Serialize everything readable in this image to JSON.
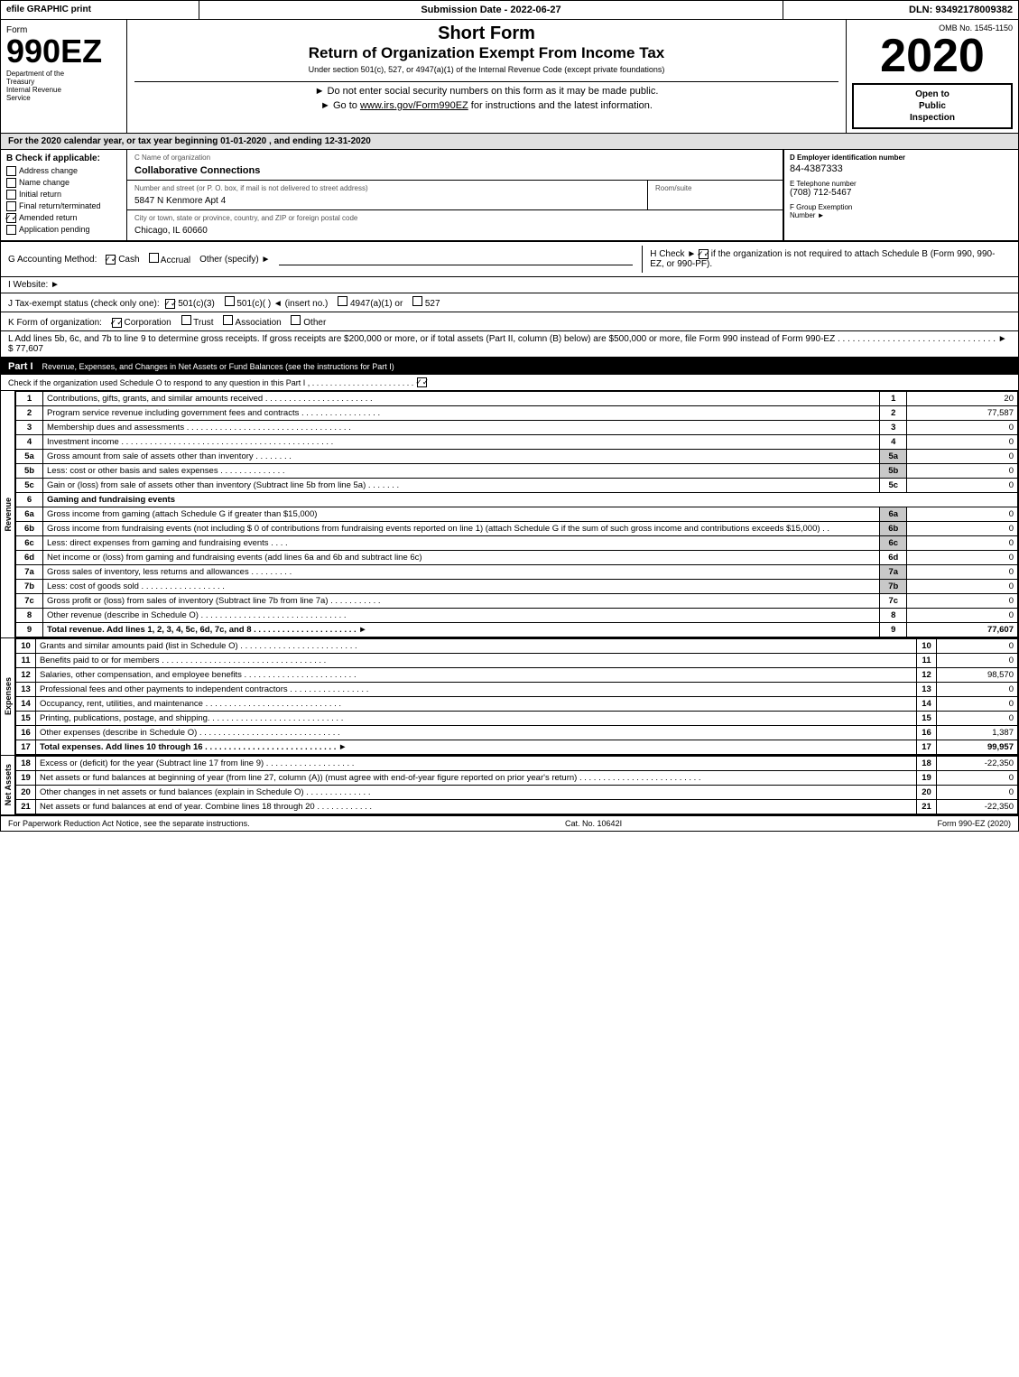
{
  "header": {
    "efile": "efile GRAPHIC print",
    "submission": "Submission Date - 2022-06-27",
    "dln": "DLN: 93492178009382"
  },
  "form_title": {
    "omb": "OMB No. 1545-1150",
    "form_name": "Form",
    "form_number": "990EZ",
    "short_form": "Short Form",
    "return_title": "Return of Organization Exempt From Income Tax",
    "under_section": "Under section 501(c), 527, or 4947(a)(1) of the Internal Revenue Code (except private foundations)",
    "do_not_enter": "► Do not enter social security numbers on this form as it may be made public.",
    "goto_irs": "► Go to www.irs.gov/Form990EZ for instructions and the latest information.",
    "year": "2020",
    "open_to_public": "Open to\nPublic\nInspection"
  },
  "dept": {
    "label": "Department of the\nTreasury",
    "irs_label": "Internal Revenue\nService"
  },
  "for_year": "For the 2020 calendar year, or tax year beginning 01-01-2020 , and ending 12-31-2020",
  "check_if_applicable": {
    "label": "B Check if applicable:",
    "items": [
      {
        "label": "Address change",
        "checked": false
      },
      {
        "label": "Name change",
        "checked": false
      },
      {
        "label": "Initial return",
        "checked": false
      },
      {
        "label": "Final return/terminated",
        "checked": false
      },
      {
        "label": "Amended return",
        "checked": true
      },
      {
        "label": "Application pending",
        "checked": false
      }
    ]
  },
  "org_info": {
    "name_label": "C Name of organization",
    "name": "Collaborative Connections",
    "address_label": "Number and street (or P. O. box, if mail is not delivered to street address)",
    "address": "5847 N Kenmore Apt 4",
    "room_label": "Room/suite",
    "room": "",
    "city_label": "City or town, state or province, country, and ZIP or foreign postal code",
    "city": "Chicago, IL  60660",
    "ein_label": "D Employer identification number",
    "ein": "84-4387333",
    "phone_label": "E Telephone number",
    "phone": "(708) 712-5467",
    "group_exempt_label": "F Group Exemption\nNumber",
    "group_exempt": "►"
  },
  "accounting": {
    "g_label": "G Accounting Method:",
    "cash_label": "Cash",
    "cash_checked": true,
    "accrual_label": "Accrual",
    "accrual_checked": false,
    "other_label": "Other (specify) ►",
    "h_label": "H  Check ►",
    "h_checked": true,
    "h_desc": "if the organization is not\nrequired to attach Schedule B\n(Form 990, 990-EZ, or 990-PF)."
  },
  "website": {
    "label": "I Website: ►"
  },
  "tax_exempt": {
    "label": "J Tax-exempt status (check only one):",
    "options": [
      {
        "label": "501(c)(3)",
        "checked": true
      },
      {
        "label": "501(c)(",
        "checked": false
      },
      {
        "label": ") ◄ (insert no.)",
        "checked": false
      },
      {
        "label": "4947(a)(1) or",
        "checked": false
      },
      {
        "label": "527",
        "checked": false
      }
    ]
  },
  "form_k": {
    "label": "K Form of organization:",
    "options": [
      {
        "label": "Corporation",
        "checked": true
      },
      {
        "label": "Trust",
        "checked": false
      },
      {
        "label": "Association",
        "checked": false
      },
      {
        "label": "Other",
        "checked": false
      }
    ]
  },
  "line_l": {
    "text": "L Add lines 5b, 6c, and 7b to line 9 to determine gross receipts. If gross receipts are $200,000 or more, or if total assets (Part II, column (B) below) are $500,000 or more, file Form 990 instead of Form 990-EZ . . . . . . . . . . . . . . . . . . . . . . . . . . . . . . . . ► $  77,607"
  },
  "part1": {
    "title": "Part I",
    "description": "Revenue, Expenses, and Changes in Net Assets or Fund Balances (see the instructions for Part I)",
    "check_text": "Check if the organization used Schedule O to respond to any question in this Part I , . . . . . . . . . . . . . . . . . . . . . . .",
    "check_checked": true,
    "lines": [
      {
        "num": "1",
        "desc": "Contributions, gifts, grants, and similar amounts received . . . . . . . . . . . . . . . . . . . . . . .",
        "linenum": "1",
        "amount": "20"
      },
      {
        "num": "2",
        "desc": "Program service revenue including government fees and contracts . . . . . . . . . . . . . . . . .",
        "linenum": "2",
        "amount": "77,587"
      },
      {
        "num": "3",
        "desc": "Membership dues and assessments . . . . . . . . . . . . . . . . . . . . . . . . . . . . . . . . . . .",
        "linenum": "3",
        "amount": "0"
      },
      {
        "num": "4",
        "desc": "Investment income . . . . . . . . . . . . . . . . . . . . . . . . . . . . . . . . . . . . . . . . . . . . .",
        "linenum": "4",
        "amount": "0"
      },
      {
        "num": "5a",
        "desc": "Gross amount from sale of assets other than inventory . . . . . . . .",
        "linenum": "5a",
        "amount": "0",
        "sub": true
      },
      {
        "num": "5b",
        "desc": "Less: cost or other basis and sales expenses . . . . . . . . . . . . . .",
        "linenum": "5b",
        "amount": "0",
        "sub": true
      },
      {
        "num": "5c",
        "desc": "Gain or (loss) from sale of assets other than inventory (Subtract line 5b from line 5a) . . . . . . .",
        "linenum": "5c",
        "amount": "0"
      },
      {
        "num": "6",
        "desc": "Gaming and fundraising events",
        "header": true
      },
      {
        "num": "6a",
        "desc": "Gross income from gaming (attach Schedule G if greater than $15,000)",
        "linenum": "6a",
        "amount": "0",
        "sub": true
      },
      {
        "num": "6b",
        "desc": "Gross income from fundraising events (not including $  0  of contributions from fundraising events reported on line 1) (attach Schedule G if the sum of such gross income and contributions exceeds $15,000)  .  .",
        "linenum": "6b",
        "amount": "0",
        "sub": true
      },
      {
        "num": "6c",
        "desc": "Less: direct expenses from gaming and fundraising events   .   .   .   .",
        "linenum": "6c",
        "amount": "0",
        "sub": true
      },
      {
        "num": "6d",
        "desc": "Net income or (loss) from gaming and fundraising events (add lines 6a and 6b and subtract line 6c)",
        "linenum": "6d",
        "amount": "0"
      },
      {
        "num": "7a",
        "desc": "Gross sales of inventory, less returns and allowances . . . . . . . . .",
        "linenum": "7a",
        "amount": "0",
        "sub": true
      },
      {
        "num": "7b",
        "desc": "Less: cost of goods sold          .  .  .  .  .  .  .  .  .  .  .  .  .  .  .  .  .  .",
        "linenum": "7b",
        "amount": "0",
        "sub": true
      },
      {
        "num": "7c",
        "desc": "Gross profit or (loss) from sales of inventory (Subtract line 7b from line 7a) . . . . . . . . . . .",
        "linenum": "7c",
        "amount": "0"
      },
      {
        "num": "8",
        "desc": "Other revenue (describe in Schedule O) . . . . . . . . . . . . . . . . . . . . . . . . . . . . . . .",
        "linenum": "8",
        "amount": "0"
      },
      {
        "num": "9",
        "desc": "Total revenue. Add lines 1, 2, 3, 4, 5c, 6d, 7c, and 8 . . . . . . . . . . . . . . . . . . . . . . ►",
        "linenum": "9",
        "amount": "77,607",
        "total": true
      }
    ]
  },
  "part1_expenses": {
    "side_label": "Expenses",
    "lines": [
      {
        "num": "10",
        "desc": "Grants and similar amounts paid (list in Schedule O) . . . . . . . . . . . . . . . . . . . . . . . . .",
        "linenum": "10",
        "amount": "0"
      },
      {
        "num": "11",
        "desc": "Benefits paid to or for members  . . . . . . . . . . . . . . . . . . . . . . . . . . . . . . . . . . .",
        "linenum": "11",
        "amount": "0"
      },
      {
        "num": "12",
        "desc": "Salaries, other compensation, and employee benefits . . . . . . . . . . . . . . . . . . . . . . . .",
        "linenum": "12",
        "amount": "98,570"
      },
      {
        "num": "13",
        "desc": "Professional fees and other payments to independent contractors . . . . . . . . . . . . . . . . .",
        "linenum": "13",
        "amount": "0"
      },
      {
        "num": "14",
        "desc": "Occupancy, rent, utilities, and maintenance . . . . . . . . . . . . . . . . . . . . . . . . . . . . .",
        "linenum": "14",
        "amount": "0"
      },
      {
        "num": "15",
        "desc": "Printing, publications, postage, and shipping. . . . . . . . . . . . . . . . . . . . . . . . . . . . .",
        "linenum": "15",
        "amount": "0"
      },
      {
        "num": "16",
        "desc": "Other expenses (describe in Schedule O) . . . . . . . . . . . . . . . . . . . . . . . . . . . . . .",
        "linenum": "16",
        "amount": "1,387"
      },
      {
        "num": "17",
        "desc": "Total expenses. Add lines 10 through 16   . . . . . . . . . . . . . . . . . . . . . . . . . . . . ►",
        "linenum": "17",
        "amount": "99,957",
        "total": true
      }
    ]
  },
  "part1_net_assets": {
    "side_label": "Net Assets",
    "lines": [
      {
        "num": "18",
        "desc": "Excess or (deficit) for the year (Subtract line 17 from line 9)  . . . . . . . . . . . . . . . . . . .",
        "linenum": "18",
        "amount": "-22,350"
      },
      {
        "num": "19",
        "desc": "Net assets or fund balances at beginning of year (from line 27, column (A)) (must agree with end-of-year figure reported on prior year's return) . . . . . . . . . . . . . . . . . . . . . . . . . .",
        "linenum": "19",
        "amount": "0"
      },
      {
        "num": "20",
        "desc": "Other changes in net assets or fund balances (explain in Schedule O) . . . . . . . . . . . . . .",
        "linenum": "20",
        "amount": "0"
      },
      {
        "num": "21",
        "desc": "Net assets or fund balances at end of year. Combine lines 18 through 20 . . . . . . . . . . . .",
        "linenum": "21",
        "amount": "-22,350"
      }
    ]
  },
  "footer": {
    "paperwork": "For Paperwork Reduction Act Notice, see the separate instructions.",
    "cat_no": "Cat. No. 10642I",
    "form": "Form 990-EZ (2020)"
  }
}
